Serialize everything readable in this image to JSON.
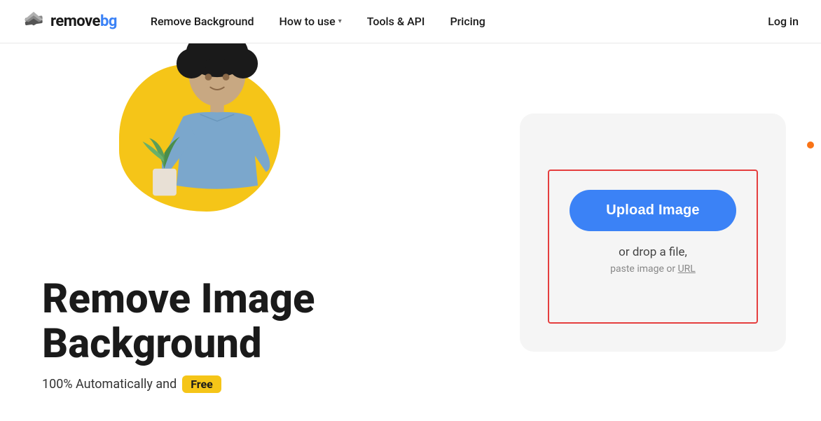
{
  "navbar": {
    "logo_text_remove": "remove",
    "logo_text_bg": "bg",
    "nav_items": [
      {
        "id": "remove-background",
        "label": "Remove Background",
        "has_caret": false
      },
      {
        "id": "how-to-use",
        "label": "How to use",
        "has_caret": true
      },
      {
        "id": "tools-api",
        "label": "Tools & API",
        "has_caret": false
      },
      {
        "id": "pricing",
        "label": "Pricing",
        "has_caret": false
      }
    ],
    "login_label": "Log in"
  },
  "hero": {
    "heading_line1": "Remove Image",
    "heading_line2": "Background",
    "subheading_text": "100% Automatically and",
    "free_badge_label": "Free"
  },
  "upload_card": {
    "upload_button_label": "Upload Image",
    "drop_text": "or drop a file,",
    "paste_text": "paste image or",
    "url_link_text": "URL"
  }
}
